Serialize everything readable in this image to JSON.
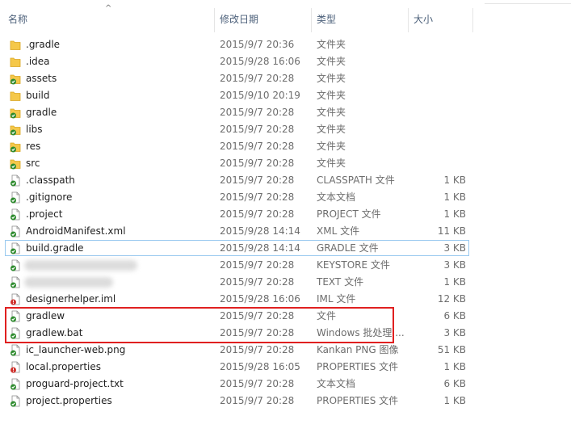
{
  "header": {
    "name": "名称",
    "date": "修改日期",
    "type": "类型",
    "size": "大小",
    "sort_indicator": "^"
  },
  "colors": {
    "folder": "#f5c84a",
    "file_green": "#2e8b2e",
    "file_red": "#d0312d",
    "selection_border": "#99c9ef",
    "highlight_box": "#e02020"
  },
  "files": [
    {
      "name": ".gradle",
      "date": "2015/9/7 20:36",
      "type": "文件夹",
      "size": "",
      "icon": "folder-icon"
    },
    {
      "name": ".idea",
      "date": "2015/9/28 16:06",
      "type": "文件夹",
      "size": "",
      "icon": "folder-icon"
    },
    {
      "name": "assets",
      "date": "2015/9/7 20:28",
      "type": "文件夹",
      "size": "",
      "icon": "folder-synced-icon"
    },
    {
      "name": "build",
      "date": "2015/9/10 20:19",
      "type": "文件夹",
      "size": "",
      "icon": "folder-icon"
    },
    {
      "name": "gradle",
      "date": "2015/9/7 20:28",
      "type": "文件夹",
      "size": "",
      "icon": "folder-synced-icon"
    },
    {
      "name": "libs",
      "date": "2015/9/7 20:28",
      "type": "文件夹",
      "size": "",
      "icon": "folder-synced-icon"
    },
    {
      "name": "res",
      "date": "2015/9/7 20:28",
      "type": "文件夹",
      "size": "",
      "icon": "folder-synced-icon"
    },
    {
      "name": "src",
      "date": "2015/9/7 20:28",
      "type": "文件夹",
      "size": "",
      "icon": "folder-synced-icon"
    },
    {
      "name": ".classpath",
      "date": "2015/9/7 20:28",
      "type": "CLASSPATH 文件",
      "size": "1 KB",
      "icon": "file-synced-icon"
    },
    {
      "name": ".gitignore",
      "date": "2015/9/7 20:28",
      "type": "文本文档",
      "size": "1 KB",
      "icon": "file-synced-icon"
    },
    {
      "name": ".project",
      "date": "2015/9/7 20:28",
      "type": "PROJECT 文件",
      "size": "1 KB",
      "icon": "file-synced-icon"
    },
    {
      "name": "AndroidManifest.xml",
      "date": "2015/9/28 14:14",
      "type": "XML 文件",
      "size": "11 KB",
      "icon": "file-synced-icon"
    },
    {
      "name": "build.gradle",
      "date": "2015/9/28 14:14",
      "type": "GRADLE 文件",
      "size": "3 KB",
      "icon": "file-synced-icon",
      "selected": true
    },
    {
      "name": "",
      "date": "2015/9/7 20:28",
      "type": "KEYSTORE 文件",
      "size": "3 KB",
      "icon": "file-synced-icon",
      "blurred": true
    },
    {
      "name": "",
      "date": "2015/9/7 20:28",
      "type": "TEXT 文件",
      "size": "1 KB",
      "icon": "file-synced-icon",
      "blurred": true
    },
    {
      "name": "designerhelper.iml",
      "date": "2015/9/28 16:06",
      "type": "IML 文件",
      "size": "12 KB",
      "icon": "file-modified-icon"
    },
    {
      "name": "gradlew",
      "date": "2015/9/7 20:28",
      "type": "文件",
      "size": "6 KB",
      "icon": "file-synced-icon"
    },
    {
      "name": "gradlew.bat",
      "date": "2015/9/7 20:28",
      "type": "Windows 批处理 ...",
      "size": "3 KB",
      "icon": "file-synced-icon"
    },
    {
      "name": "ic_launcher-web.png",
      "date": "2015/9/7 20:28",
      "type": "Kankan PNG 图像",
      "size": "51 KB",
      "icon": "file-synced-icon"
    },
    {
      "name": "local.properties",
      "date": "2015/9/28 16:05",
      "type": "PROPERTIES 文件",
      "size": "1 KB",
      "icon": "file-modified-icon"
    },
    {
      "name": "proguard-project.txt",
      "date": "2015/9/7 20:28",
      "type": "文本文档",
      "size": "6 KB",
      "icon": "file-synced-icon"
    },
    {
      "name": "project.properties",
      "date": "2015/9/7 20:28",
      "type": "PROPERTIES 文件",
      "size": "1 KB",
      "icon": "file-synced-icon"
    }
  ]
}
